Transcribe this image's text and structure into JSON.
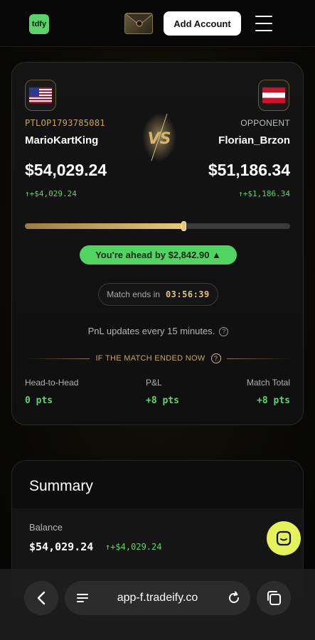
{
  "header": {
    "logo_text": "tdfy",
    "add_account_label": "Add Account"
  },
  "match": {
    "player": {
      "flag": "us-flag-icon",
      "account_id": "PTLOP1793785081",
      "name": "MarioKartKing",
      "balance": "$54,029.24",
      "change": "↑+$4,029.24"
    },
    "opponent": {
      "flag": "austria-flag-icon",
      "label": "OPPONENT",
      "name": "Florian_Brzon",
      "balance": "$51,186.34",
      "change": "↑+$1,186.34"
    },
    "vs_text": "VS",
    "progress_fraction": 0.6,
    "ahead_text": "You're ahead by $2,842.90 ▲",
    "ends_label": "Match ends in",
    "ends_time": "03:56:39",
    "pnl_note": "PnL updates every 15 minutes.",
    "if_ended_label": "IF THE MATCH ENDED NOW",
    "stats": [
      {
        "label": "Head-to-Head",
        "value": "0 pts"
      },
      {
        "label": "P&L",
        "value": "+8 pts"
      },
      {
        "label": "Match Total",
        "value": "+8 pts"
      }
    ]
  },
  "summary": {
    "title": "Summary",
    "balance_label": "Balance",
    "balance_value": "$54,029.24",
    "balance_change": "↑+$4,029.24"
  },
  "browser": {
    "url": "app-f.tradeify.co"
  },
  "colors": {
    "accent_green": "#52d462",
    "gold": "#c9a45c",
    "chat_yellow": "#e5f25a"
  }
}
